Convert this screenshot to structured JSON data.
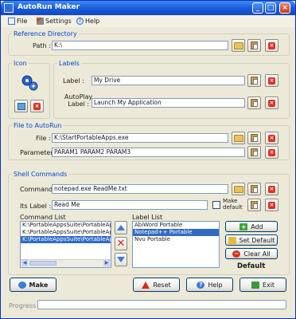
{
  "window": {
    "title": "AutoRun Maker"
  },
  "menu": {
    "file": "File",
    "settings": "Settings",
    "help": "Help"
  },
  "reference": {
    "legend": "Reference Directory",
    "path_label": "Path :",
    "path_value": "K:\\"
  },
  "icon_group": {
    "legend": "Icon"
  },
  "labels": {
    "legend": "Labels",
    "label_label": "Label :",
    "label_value": "My Drive",
    "autoplay_label": "AutoPlay\nLabel :",
    "autoplay_value": "Launch My Application"
  },
  "file_to_autorun": {
    "legend": "File to AutoRun",
    "file_label": "File :",
    "file_value": "K:\\StartPortableApps.exe",
    "params_label": "Parameters :",
    "params_value": "PARAM1 PARAM2 PARAM3"
  },
  "shell": {
    "legend": "Shell Commands",
    "command_label": "Command :",
    "command_value": "notepad.exe ReadMe.txt",
    "its_label_label": "Its Label :",
    "its_label_value": "Read Me",
    "make_default_label": "Make\ndefault",
    "command_list_label": "Command List",
    "command_list": [
      {
        "text": "K:\\PortableAppsSuite\\PortableApps",
        "selected": false
      },
      {
        "text": "K:\\PortableAppsSuite\\PortableApps",
        "selected": false
      },
      {
        "text": "K:\\PortableAppsSuite\\PortableApps",
        "selected": true
      }
    ],
    "label_list_label": "Label List",
    "label_list": [
      {
        "text": "AbiWord Portable",
        "selected": false
      },
      {
        "text": "Notepad++ Portable",
        "selected": true
      },
      {
        "text": "Nvu Portable",
        "selected": false
      }
    ],
    "add_label": "Add",
    "set_default_label": "Set Default",
    "clear_all_label": "Clear All",
    "default_text": "Default"
  },
  "footer": {
    "make_label": "Make",
    "reset_label": "Reset",
    "help_label": "Help",
    "exit_label": "Exit",
    "progress_label": "Progress"
  },
  "colors": {
    "titlebar": "#1859d9",
    "legend": "#0046d5",
    "selection": "#316ac5",
    "background": "#ece9d8"
  }
}
